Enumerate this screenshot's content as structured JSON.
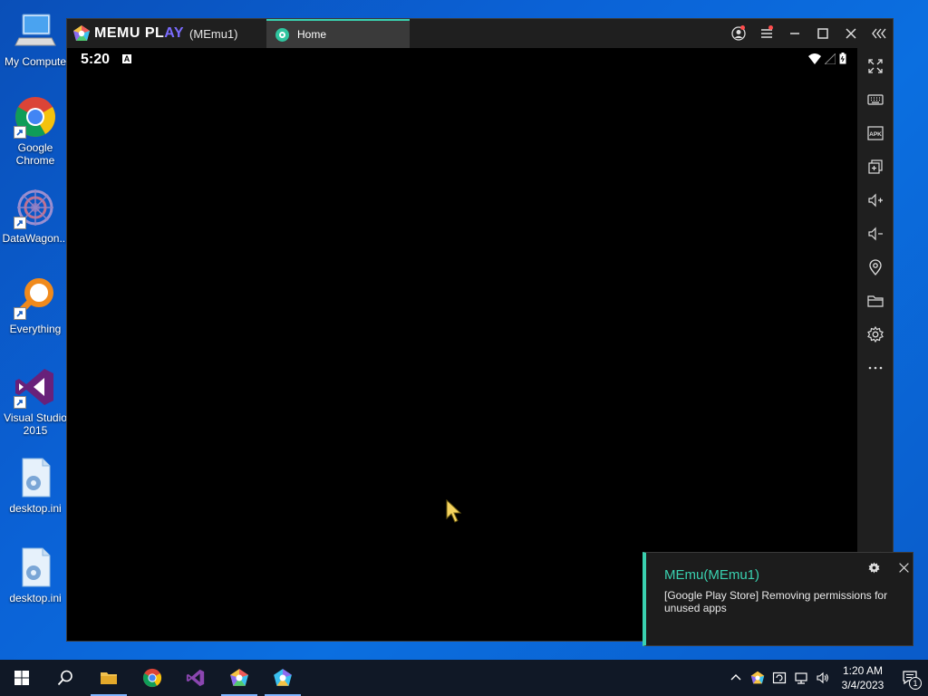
{
  "desktop": {
    "icons": [
      {
        "label": "My Compute",
        "icon": "computer-icon"
      },
      {
        "label": "Google Chrome",
        "icon": "chrome-icon"
      },
      {
        "label": "DataWagon...",
        "icon": "datawagon-icon"
      },
      {
        "label": "Everything",
        "icon": "everything-search-icon"
      },
      {
        "label": "Visual Studio 2015",
        "icon": "visual-studio-icon"
      },
      {
        "label": "desktop.ini",
        "icon": "settings-file-icon"
      },
      {
        "label": "desktop.ini",
        "icon": "settings-file-icon"
      }
    ]
  },
  "emulator": {
    "brand_name_a": "MEMU PL",
    "brand_name_b": "AY",
    "instance": "(MEmu1)",
    "tab_label": "Home",
    "status_time": "5:20",
    "status_badge": "A",
    "title_controls": [
      "account-icon",
      "menu-icon",
      "minimize-icon",
      "maximize-icon",
      "close-icon",
      "collapse-toolbar-icon"
    ],
    "toolbar": [
      "fullscreen-icon",
      "keyboard-icon",
      "apk-icon",
      "multi-instance-icon",
      "volume-up-icon",
      "volume-down-icon",
      "location-icon",
      "folder-icon",
      "settings-icon",
      "more-icon",
      "back-icon"
    ],
    "apk_text": "APK"
  },
  "toast": {
    "title": "MEmu(MEmu1)",
    "body": "[Google Play Store] Removing permissions for unused apps"
  },
  "taskbar": {
    "items": [
      "start-icon",
      "search-icon",
      "file-explorer-icon",
      "chrome-icon",
      "visual-studio-icon",
      "memu-icon",
      "memu-multi-icon"
    ],
    "time": "1:20 AM",
    "date": "3/4/2023",
    "notification_count": "1"
  },
  "colors": {
    "accent": "#3ad1b0",
    "taskbar": "#101826",
    "desktop": "#0b62d6"
  }
}
